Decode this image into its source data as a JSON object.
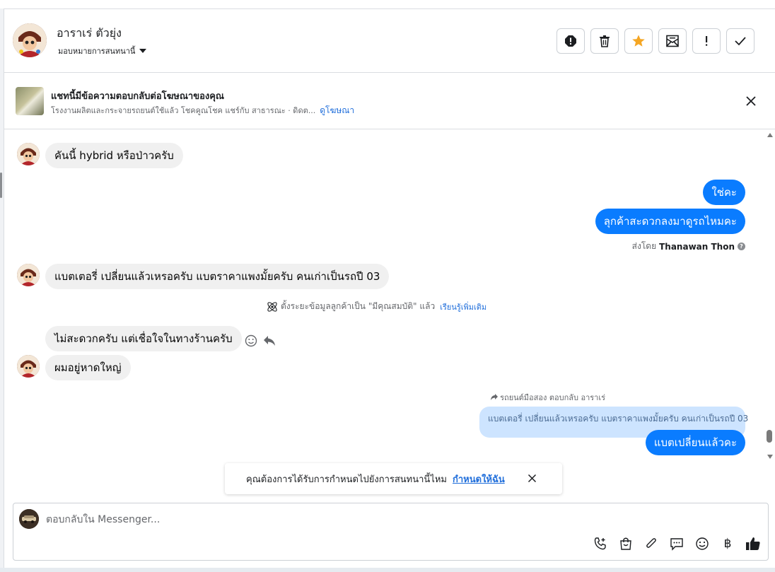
{
  "header": {
    "contact_name": "อาราเร่ ตัวยุ่ง",
    "assign_label": "มอบหมายการสนทนานี้",
    "toolbar": [
      "spam-icon",
      "trash-icon",
      "star-icon",
      "mark-unread-icon",
      "follow-up-icon",
      "done-icon"
    ]
  },
  "ad": {
    "title": "แชทนี้มีข้อความตอบกลับต่อโฆษณาของคุณ",
    "subtitle": "โรงงานผลิตและกระจายรถยนต์ใช้แล้ว โชคคูณโชค แชร์กับ สาธารณะ · ดิดต...",
    "link": "ดูโฆษณา"
  },
  "messages": {
    "m1": "คันนี้ hybrid หรือป่าวครับ",
    "m2": "ใช่คะ",
    "m3": "ลุกค้าสะดวกลงมาดูรถไหมคะ",
    "sent_by_label": "ส่งโดย",
    "sent_by_name": "Thanawan Thon",
    "m4": "แบตเตอรี่ เปลี่ยนแล้วเหรอครับ แบตราคาแพงมั้ยครับ คนเก่าเป็นรถปี 03",
    "system_note": "ตั้งระยะข้อมูลลูกค้าเป็น \"มีคุณสมบัติ\" แล้ว",
    "system_link": "เรียนรู้เพิ่มเติม",
    "m5": "ไม่สะดวกครับ แต่เชื่อใจในทางร้านครับ",
    "m6": "ผมอยู่หาดใหญ่",
    "reply_meta": "รถยนต์มือสอง ตอบกลับ อาราเร่",
    "quoted": "แบตเตอรี่ เปลี่ยนแล้วเหรอครับ แบตราคาแพงมั้ยครับ คนเก่าเป็นรถปี 03",
    "m7": "แบตเปลี่ยนแล้วคะ"
  },
  "notice": {
    "text": "คุณต้องการได้รับการกำหนดไปยังการสนทนานี้ไหม",
    "link": "กำหนดให้ฉัน"
  },
  "composer": {
    "placeholder": "ตอบกลับใน Messenger...",
    "currency_symbol": "฿",
    "tools": [
      "phone-add-icon",
      "shopping-bag-icon",
      "paperclip-icon",
      "saved-reply-icon",
      "emoji-icon",
      "baht-icon",
      "thumbs-up-icon"
    ]
  },
  "colors": {
    "outgoing_bubble": "#0a7cff",
    "incoming_bubble": "#f0f0f0",
    "quoted_bubble": "#cde4ff",
    "link": "#216fdb",
    "star": "#f5a623"
  }
}
